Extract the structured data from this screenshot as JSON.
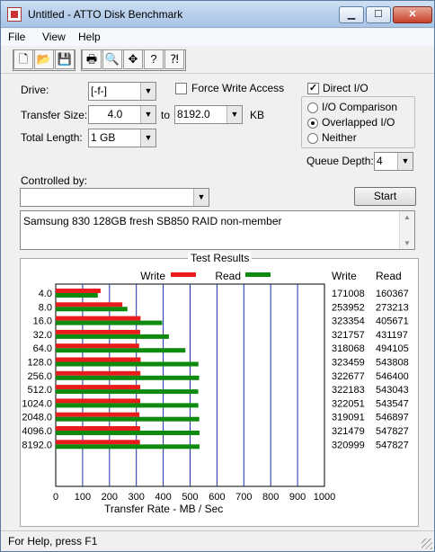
{
  "window": {
    "title": "Untitled - ATTO Disk Benchmark",
    "min_glyph": "▁",
    "max_glyph": "☐",
    "close_glyph": "✕"
  },
  "menu": [
    "File",
    "View",
    "Help"
  ],
  "toolbar": {
    "icons": [
      "new-file-icon",
      "open-folder-icon",
      "save-icon",
      "print-icon",
      "print-preview-icon",
      "move-icon",
      "help-icon",
      "context-help-icon"
    ],
    "glyphs": [
      "🗋",
      "📂",
      "💾",
      "🖶",
      "🔍",
      "✥",
      "?",
      "⁈"
    ]
  },
  "form": {
    "drive_label": "Drive:",
    "drive_value": "[-f-]",
    "force_write_label": "Force Write Access",
    "direct_io_label": "Direct I/O",
    "transfer_size_label": "Transfer Size:",
    "transfer_from": "4.0",
    "to_label": "to",
    "transfer_to": "8192.0",
    "kb_label": "KB",
    "total_length_label": "Total Length:",
    "total_length_value": "1 GB",
    "io_comparison_label": "I/O Comparison",
    "overlapped_io_label": "Overlapped I/O",
    "neither_label": "Neither",
    "queue_depth_label": "Queue Depth:",
    "queue_depth_value": "4",
    "controlled_by_label": "Controlled by:",
    "controlled_by_value": "",
    "start_label": "Start",
    "description": "Samsung 830 128GB fresh SB850 RAID non-member"
  },
  "options": {
    "force_write_access": false,
    "direct_io": true,
    "selected_mode": "Overlapped I/O"
  },
  "results": {
    "title": "Test Results",
    "write_legend": "Write",
    "read_legend": "Read",
    "write_col": "Write",
    "read_col": "Read"
  },
  "chart_data": {
    "type": "bar",
    "orientation": "horizontal",
    "categories": [
      "4.0",
      "8.0",
      "16.0",
      "32.0",
      "64.0",
      "128.0",
      "256.0",
      "512.0",
      "1024.0",
      "2048.0",
      "4096.0",
      "8192.0"
    ],
    "series": [
      {
        "name": "Write",
        "color": "#e81c1c",
        "values": [
          171008,
          253952,
          323354,
          321757,
          318068,
          323459,
          322677,
          322183,
          322051,
          319091,
          321479,
          320999
        ]
      },
      {
        "name": "Read",
        "color": "#0e8a0e",
        "values": [
          160367,
          273213,
          405671,
          431197,
          494105,
          543808,
          546400,
          543043,
          543547,
          546897,
          547827,
          547827
        ]
      }
    ],
    "xlabel": "Transfer Rate - MB / Sec",
    "xlim": [
      0,
      1000
    ],
    "xticks": [
      "0",
      "100",
      "200",
      "300",
      "400",
      "500",
      "600",
      "700",
      "800",
      "900",
      "1000"
    ],
    "grid": true,
    "legend": "top"
  },
  "status": {
    "text": "For Help, press F1"
  }
}
